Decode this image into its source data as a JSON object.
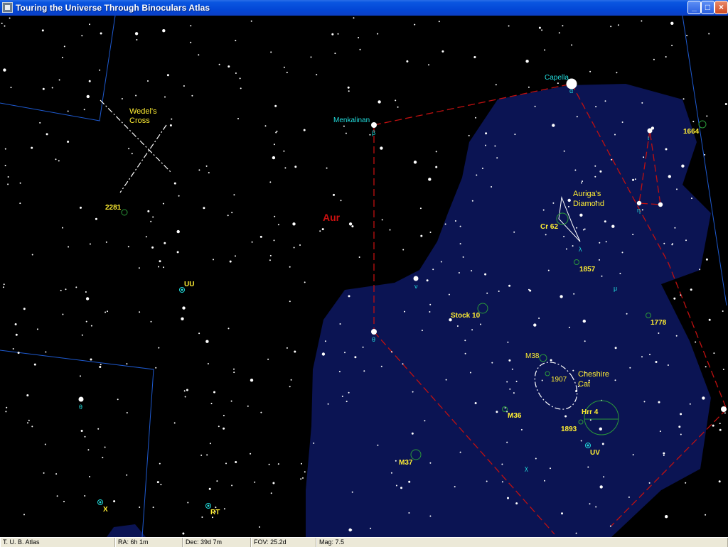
{
  "window": {
    "title": "Touring the Universe Through Binoculars Atlas",
    "buttons": {
      "minimize": "_",
      "maximize": "□",
      "close": "×"
    }
  },
  "map": {
    "constellation": "Aur",
    "stars": [
      {
        "name": "Capella",
        "symbol": "α"
      },
      {
        "name": "Menkalinan",
        "symbol": "β"
      }
    ],
    "greek_labels": [
      "θ",
      "ν",
      "λ",
      "μ",
      "ι",
      "η",
      "χ"
    ],
    "asterisms": [
      {
        "name": "Wedel's\nCross",
        "line1": "Wedel's",
        "line2": "Cross"
      },
      {
        "name": "Auriga's Diamond",
        "line1": "Auriga's",
        "line2": "Diamond"
      },
      {
        "name": "Cheshire Cat",
        "line1": "Cheshire",
        "line2": "Cat"
      }
    ],
    "objects": [
      "2281",
      "1664",
      "Cr 62",
      "1857",
      "Stock 10",
      "1778",
      "M38",
      "1907",
      "M36",
      "1893",
      "Hrr 4",
      "M37",
      "UU",
      "UV",
      "X",
      "RT"
    ],
    "colors": {
      "accent": "#ffee33",
      "cyan": "#22dddd",
      "red": "#cc1010",
      "nebula": "#0b1453",
      "boundary": "#1e5ad0",
      "cluster": "#2b9a3a"
    }
  },
  "status": {
    "app": "T. U. B. Atlas",
    "ra": "RA: 6h 1m",
    "dec": "Dec: 39d 7m",
    "fov": "FOV: 25.2d",
    "mag": "Mag: 7.5"
  }
}
